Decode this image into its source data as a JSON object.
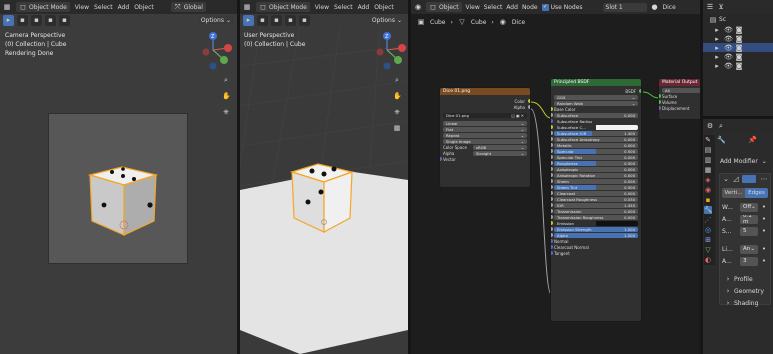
{
  "v1": {
    "mode": "Object Mode",
    "menus": [
      "View",
      "Select",
      "Add",
      "Object"
    ],
    "transform": "Global",
    "options": "Options",
    "line1": "Camera Perspective",
    "line2": "(0) Collection | Cube",
    "line3": "Rendering Done"
  },
  "v2": {
    "mode": "Object Mode",
    "menus": [
      "View",
      "Select",
      "Add",
      "Object"
    ],
    "options": "Options",
    "line1": "User Perspective",
    "line2": "(0) Collection | Cube"
  },
  "ne": {
    "type": "Object",
    "menus": [
      "View",
      "Select",
      "Add",
      "Node"
    ],
    "use_nodes": "Use Nodes",
    "slot": "Slot 1",
    "material": "Dice",
    "crumbs": [
      "Cube",
      "Cube",
      "Dice"
    ]
  },
  "img_node": {
    "title": "Dice 01.png",
    "outputs": [
      "Color",
      "Alpha"
    ],
    "image": "Dice 01.png",
    "opts": [
      "Linear",
      "Flat",
      "Repeat",
      "Single Image"
    ],
    "cs_label": "Color Space",
    "cs": "sRGB",
    "alpha_label": "Alpha",
    "alpha": "Straight",
    "vector": "Vector"
  },
  "bsdf": {
    "title": "Principled BSDF",
    "out": "BSDF",
    "dist": "GGX",
    "ss": "Random Walk",
    "base_color": "Base Color",
    "rows": [
      {
        "l": "Subsurface",
        "v": "0.000"
      },
      {
        "l": "Subsurface Radius",
        "v": ""
      },
      {
        "l": "Subsurface C...",
        "v": ""
      },
      {
        "l": "Subsurface IOR",
        "v": "1.400"
      },
      {
        "l": "Subsurface Anisotropy",
        "v": "0.000"
      },
      {
        "l": "Metallic",
        "v": "0.000"
      },
      {
        "l": "Specular",
        "v": "0.500"
      },
      {
        "l": "Specular Tint",
        "v": "0.000"
      },
      {
        "l": "Roughness",
        "v": "0.500"
      },
      {
        "l": "Anisotropic",
        "v": "0.000"
      },
      {
        "l": "Anisotropic Rotation",
        "v": "0.000"
      },
      {
        "l": "Sheen",
        "v": "0.000"
      },
      {
        "l": "Sheen Tint",
        "v": "0.500"
      },
      {
        "l": "Clearcoat",
        "v": "0.000"
      },
      {
        "l": "Clearcoat Roughness",
        "v": "0.030"
      },
      {
        "l": "IOR",
        "v": "1.450"
      },
      {
        "l": "Transmission",
        "v": "0.000"
      },
      {
        "l": "Transmission Roughness",
        "v": "0.000"
      },
      {
        "l": "Emission",
        "v": ""
      },
      {
        "l": "Emission Strength",
        "v": "1.000"
      },
      {
        "l": "Alpha",
        "v": "1.000"
      }
    ],
    "bottom": [
      "Normal",
      "Clearcoat Normal",
      "Tangent"
    ]
  },
  "mat_out": {
    "title": "Material Output",
    "target": "All",
    "inputs": [
      "Surface",
      "Volume",
      "Displacement"
    ]
  },
  "outliner": {
    "scene": "Sc"
  },
  "props": {
    "add_modifier": "Add Modifier",
    "tab1": "Verti...",
    "tab2": "Edges",
    "r1l": "W...",
    "r1v": "Off",
    "r2l": "A...",
    "r2v": "0.1 m",
    "r3l": "S...",
    "r3v": "5",
    "r4l": "Li...",
    "r4v": "An",
    "r5l": "A...",
    "r5v": "3",
    "sections": [
      "Profile",
      "Geometry",
      "Shading"
    ]
  },
  "colors": {
    "accent": "#4772b3",
    "orange": "#f5a623",
    "bsdf_header": "#2e6b34",
    "img_header": "#7a4a20",
    "out_header": "#6b2633"
  }
}
